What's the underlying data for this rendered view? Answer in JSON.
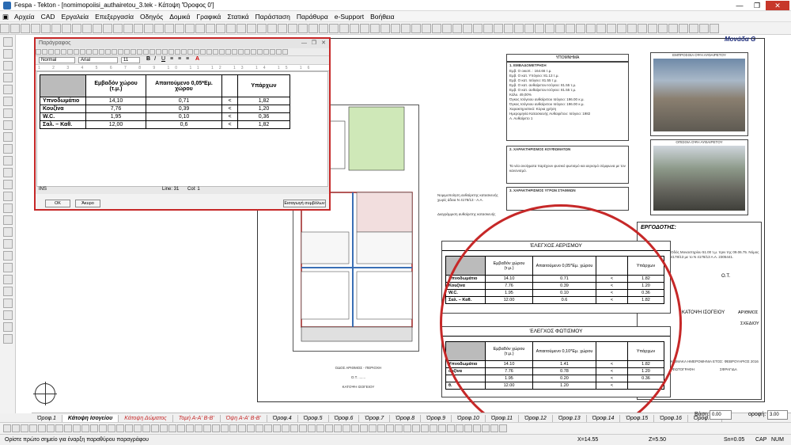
{
  "window": {
    "title": "Fespa - Tekton - [nomimopoiisi_authairetou_3.tek - Κάτοψη 'Όροφος 0']",
    "minimize": "—",
    "maximize": "❐",
    "close": "✕"
  },
  "menu": [
    "Αρχεία",
    "CAD",
    "Εργαλεία",
    "Επεξεργασία",
    "Οδηγός",
    "Δομικά",
    "Γραφικά",
    "Στατικά",
    "Παράσταση",
    "Παράθυρα",
    "e-Support",
    "Βοήθεια"
  ],
  "sheet": {
    "monada": "Μονάδα G"
  },
  "legend": {
    "title": "ΥΠΟΜΝΗΜΑ",
    "s1": "1. ΕΜΒΑΔΟΜΕΤΡΗΣΗ",
    "s1_lines": [
      "Εμβ. Ο οικοπ. : 164.66 τ.μ.",
      "Εμβ. Ο κατ. Υπόγειο: 81.13 τ.μ.",
      "Εμβ. Ο κατ. Ισόγειο: 81.55 τ.μ.",
      "Εμβ. Ο κατ. αυθαίρετου Ισόγειο: 81.55 τ.μ.",
      "Εμβ. Ο κατ. αυθαίρετου Ισόγειο: 81.55 τ.μ.",
      "Κάλυ. 49,00%",
      "Όγκος Ισόγειου αυθαίρετου Ισόγειο: 196.00 κ.μ.",
      "Όγκος Ισόγειου αυθαίρετου Ισόγειο: 196.00 κ.μ.",
      "Χαρακτηριστικό: Κύρια χρήση",
      "Ημερομηνία Κατασκευής Αυθαιρέτου: Ισόγειο: 1982",
      "Α. Αυθαίρετο 1"
    ],
    "s2": "2. ΧΑΡΑΚΤΗΡΙΣΜΟΣ ΚΟΥΦΩΜΑΤΩΝ",
    "s2_text": "Τα νέα ανοίγματα παρέχουν φυσικό φωτισμό και αερισμό σύμφωνα με τον κανονισμό.",
    "s3": "3. ΧΑΡΑΚΤΗΡΙΣΜΟΣ ΥΓΡΩΝ ΣΤΑΘΜΩΝ"
  },
  "photos": {
    "front": "ΕΜΠΡΟΣΘΙΑ ΟΨΗ ΑΥΘΑΙΡΕΤΟΥ",
    "back": "ΟΠΙΣΘΙΑ ΟΨΗ ΑΥΘΑΙΡΕΤΟΥ"
  },
  "titleblock": {
    "ergodotis": "ΕΡΓΟΔΟΤΗΣ:",
    "address": "Οδός Μοναστηρίου 51.00 τ.μ. πριν της 09.06.75. Νόμος 4178/13 με το Ν 4178/13 Α.Α. 2305441.",
    "ot": "Ο.Τ.",
    "drawing": "ΚΑΤΟΨΗ ΙΣΟΓΕΙΟΥ",
    "arithmos": "ΑΡΙΘΜΟΣ",
    "sxediou": "ΣΧΕΔΙΟΥ",
    "date": "ΚΛΙΜΑΚΑ ΗΜΕΡΟΜΗΝΙΑ ΕΤΟΣ: ΦΕΒΡΟΥΑΡΙΟΣ 2016",
    "graph": "ΦΩΤΟΓΡΑΦΗ",
    "sfragida": "ΣΦΡΑΓΙΔΑ"
  },
  "plan": {
    "street": "ΟΔΟΣ ΑΡΙΘΜΟΣ - ΠΕΡΙΟΧΗ",
    "ot": "Ο.Τ. .......",
    "caption": "ΚΑΤΟΨΗ ΙΣΟΓΕΙΟΥ",
    "note1": "Νομιμοποίηση αυθαίρετης κατασκευής χωρίς άδεια Ν 4178/13 - Α.Α.",
    "note2": "Διαγράμμιση αυθαίρετης κατασκευής"
  },
  "dialog": {
    "title": "Παράγραφος",
    "style": "Normal",
    "font": "Arial",
    "size": "11",
    "ruler": "1 2 3 4 5 6 7 8 9 10 11 12 13 14 15 16",
    "status_left": "INS",
    "line": "Line: 31",
    "col": "Col: 1",
    "ok": "OK",
    "cancel": "Άκυρο",
    "insert": "Εισαγωγή συμβόλων",
    "headers": [
      "Εμβαδόν χώρου (τ.μ.)",
      "Απαιτούμενο 0,05*Εμ. χώρου",
      "",
      "Υπάρχων"
    ],
    "rows": [
      [
        "Υπνοδωμάτιο",
        "14,10",
        "0,71",
        "<",
        "1,82"
      ],
      [
        "Κουζίνα",
        "7,76",
        "0,39",
        "<",
        "1,20"
      ],
      [
        "W.C.",
        "1,95",
        "0,10",
        "<",
        "0,36"
      ],
      [
        "Σαλ. – Καθ.",
        "12,00",
        "0,6",
        "<",
        "1,82"
      ]
    ]
  },
  "check_air": {
    "title": "ΈΛΕΓΧΟΣ ΑΕΡΙΣΜΟΥ",
    "headers": [
      "Εμβαδόν χώρου (τ.μ.)",
      "Απαιτούμενο 0,05*Εμ. χώρου",
      "",
      "Υπάρχων"
    ],
    "rows": [
      [
        "Υπνοδωμάτιο",
        "14.10",
        "0.71",
        "<",
        "1.82"
      ],
      [
        "Κουζίνα",
        "7.76",
        "0.39",
        "<",
        "1.20"
      ],
      [
        "W.C.",
        "1.95",
        "0.10",
        "<",
        "0.36"
      ],
      [
        "Σαλ. – Καθ.",
        "12.00",
        "0.6",
        "<",
        "1.82"
      ]
    ]
  },
  "check_light": {
    "title": "ΈΛΕΓΧΟΣ ΦΩΤΙΣΜΟΥ",
    "headers": [
      "Εμβαδόν χώρου (τ.μ.)",
      "Απαιτούμενο 0,10*Εμ. χώρου",
      "",
      "Υπάρχων"
    ],
    "rows": [
      [
        "Υπνοδωμάτιο",
        "14.10",
        "1.41",
        "<",
        "1.82"
      ],
      [
        "ουζίνα",
        "7.76",
        "0.78",
        "<",
        "1.20"
      ],
      [
        "",
        "1.95",
        "0.20",
        "<",
        "0.36"
      ],
      [
        "θ.",
        "12.00",
        "1.20",
        "<",
        ""
      ]
    ]
  },
  "tabs": [
    "Όροφ.1",
    "Κάτοψη Ισογείου",
    "Κάτοψη Δώματος",
    "Τομή Α-Α' Β-Β'",
    "Όψη Α-Α' Β-Β'",
    "Όροφ.4",
    "Όροφ.5",
    "Όροφ.6",
    "Όροφ.7",
    "Όροφ.8",
    "Όροφ.9",
    "Όροφ.10",
    "Όροφ.11",
    "Όροφ.12",
    "Όροφ.13",
    "Όροφ.14",
    "Όροφ.15",
    "Όροφ.16",
    "Όροφ.17"
  ],
  "fields": {
    "vasi_label": "Βάση:",
    "vasi": "0.00",
    "orofi_label": "οροφή:",
    "orofi": "3.00"
  },
  "status": {
    "prompt": "Ορίστε πρώτο σημείο για έναρξη παραθύρου παραγράφου",
    "x": "X=14.55",
    "z": "Z=5.50",
    "sn": "Sn=0.05",
    "caps": "CAP",
    "num": "NUM"
  },
  "colors": {
    "accent": "#c62828",
    "title_blue": "#1a2a7a"
  }
}
